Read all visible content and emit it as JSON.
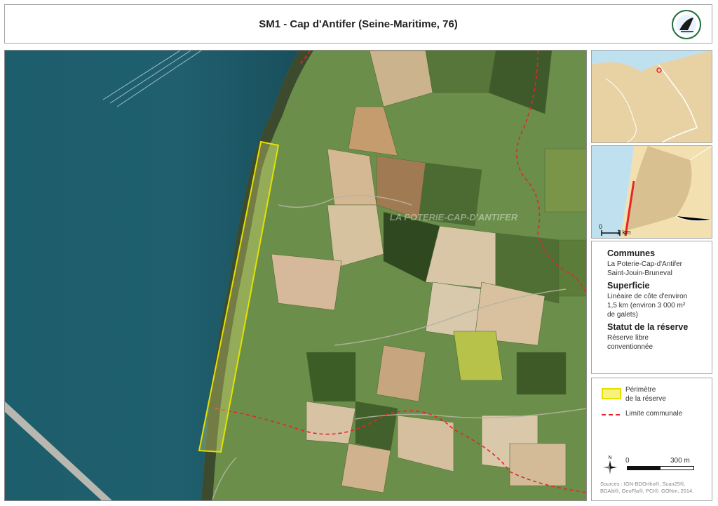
{
  "header": {
    "title": "SM1 - Cap d'Antifer (Seine-Maritime, 76)"
  },
  "map": {
    "area_label": "LA POTERIE-CAP-D'ANTIFER"
  },
  "inset_locator": {
    "scale_zero": "0",
    "scale_unit": "1 km"
  },
  "info": {
    "communes_heading": "Communes",
    "communes": [
      "La Poterie-Cap-d'Antifer",
      "Saint-Jouin-Bruneval"
    ],
    "surface_heading": "Superficie",
    "surface_lines": [
      "Linéaire de côte d'environ",
      "1,5 km (environ 3 000 m²",
      "de galets)"
    ],
    "status_heading": "Statut de la réserve",
    "status_lines": [
      "Réserve libre",
      "conventionnée"
    ]
  },
  "legend": {
    "perimeter_lines": [
      "Périmètre",
      "de la réserve"
    ],
    "boundary_label": "Limite communale",
    "north_label": "N",
    "scale_zero": "0",
    "scale_end": "300 m",
    "sources_lines": [
      "Sources : IGN-BDOrtho®, Scan25®,",
      "BDAlti®, GeoFla®, PCI®. GONm, 2014."
    ]
  },
  "colors": {
    "perimeter": "#e5e000",
    "perimeter_fill": "#f6f27a",
    "boundary": "#e3262b",
    "sea": "#1f5a68",
    "land_inset": "#e8d2a4"
  }
}
